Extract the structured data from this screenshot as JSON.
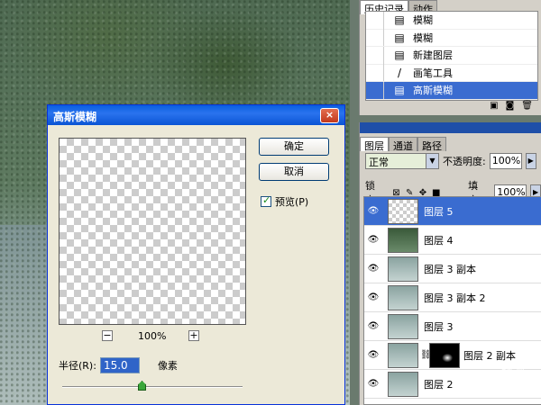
{
  "dialog": {
    "title": "高斯模糊",
    "close_icon": "×",
    "ok_label": "确定",
    "cancel_label": "取消",
    "preview_label": "预览(P)",
    "preview_checked": true,
    "zoom_minus": "−",
    "zoom_plus": "+",
    "zoom_value": "100%",
    "radius_label": "半径(R):",
    "radius_value": "15.0",
    "radius_unit": "像素",
    "slider_fraction": 0.44
  },
  "history": {
    "tabs": [
      "历史记录",
      "动作"
    ],
    "items": [
      {
        "label": "模糊",
        "icon": "history-state-icon",
        "selected": false
      },
      {
        "label": "模糊",
        "icon": "history-state-icon",
        "selected": false
      },
      {
        "label": "新建图层",
        "icon": "history-state-icon",
        "selected": false
      },
      {
        "label": "画笔工具",
        "icon": "brush-icon",
        "selected": false
      },
      {
        "label": "高斯模糊",
        "icon": "history-state-icon",
        "selected": true
      }
    ]
  },
  "layers_panel": {
    "tabs": [
      "图层",
      "通道",
      "路径"
    ],
    "blend_mode": "正常",
    "opacity_label": "不透明度:",
    "opacity_value": "100%",
    "lock_label": "锁定:",
    "fill_label": "填充:",
    "fill_value": "100%",
    "layers": [
      {
        "name": "图层 5",
        "selected": true
      },
      {
        "name": "图层 4",
        "selected": false
      },
      {
        "name": "图层 3 副本",
        "selected": false
      },
      {
        "name": "图层 3 副本 2",
        "selected": false
      },
      {
        "name": "图层 3",
        "selected": false
      },
      {
        "name": "图层 2 副本",
        "selected": false
      },
      {
        "name": "图层 2",
        "selected": false
      }
    ]
  },
  "watermark": "经验",
  "colors": {
    "title_bar": "#0a54d4",
    "selection": "#3a6cd0",
    "panel_bg": "#d4d0c8",
    "dialog_bg": "#ece9d8"
  }
}
